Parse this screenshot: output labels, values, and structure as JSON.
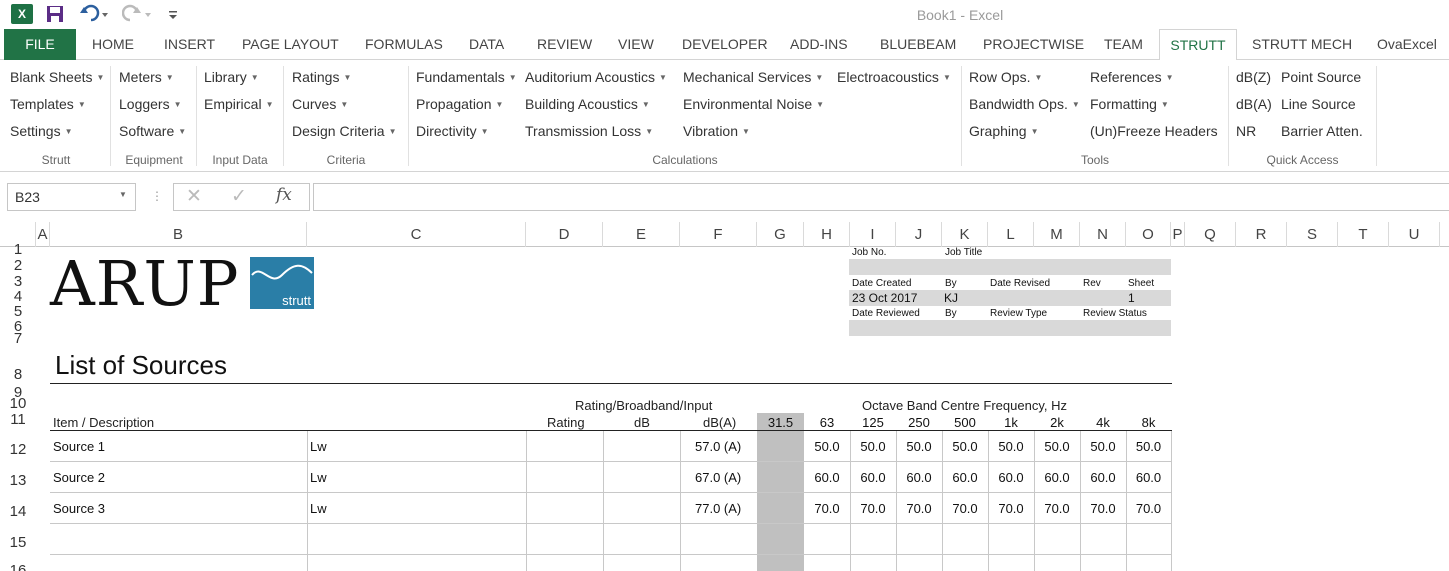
{
  "titlebar": {
    "app_logo": "X",
    "window_title": "Book1 - Excel",
    "icons": [
      "excel-icon",
      "save-icon",
      "undo-icon",
      "redo-icon",
      "customize-qat-icon"
    ]
  },
  "tabs": {
    "file": "FILE",
    "items": [
      "HOME",
      "INSERT",
      "PAGE LAYOUT",
      "FORMULAS",
      "DATA",
      "REVIEW",
      "VIEW",
      "DEVELOPER",
      "ADD-INS",
      "BLUEBEAM",
      "PROJECTWISE",
      "TEAM",
      "STRUTT",
      "STRUTT MECH",
      "OvaExcel"
    ],
    "active": "STRUTT"
  },
  "ribbon": {
    "strutt": {
      "label": "Strutt",
      "items": [
        "Blank Sheets",
        "Templates",
        "Settings"
      ]
    },
    "equipment": {
      "label": "Equipment",
      "items": [
        "Meters",
        "Loggers",
        "Software"
      ]
    },
    "input_data": {
      "label": "Input Data",
      "items": [
        "Library",
        "Empirical"
      ]
    },
    "criteria": {
      "label": "Criteria",
      "items": [
        "Ratings",
        "Curves",
        "Design Criteria"
      ]
    },
    "calculations": {
      "label": "Calculations",
      "col1": [
        "Fundamentals",
        "Propagation",
        "Directivity"
      ],
      "col2": [
        "Auditorium Acoustics",
        "Building Acoustics",
        "Transmission Loss"
      ],
      "col3": [
        "Mechanical Services",
        "Environmental Noise",
        "Vibration"
      ],
      "col4": [
        "Electroacoustics"
      ]
    },
    "tools": {
      "label": "Tools",
      "col1": [
        "Row Ops.",
        "Bandwidth Ops.",
        "Graphing"
      ],
      "col2": [
        "References",
        "Formatting",
        "(Un)Freeze Headers"
      ]
    },
    "quick_access": {
      "label": "Quick Access",
      "col1": [
        "dB(Z)",
        "dB(A)",
        "NR"
      ],
      "col2": [
        "Point Source",
        "Line Source",
        "Barrier Atten."
      ]
    }
  },
  "formula_bar": {
    "name_box": "B23",
    "formula": "",
    "fx": "fx",
    "cancel": "✕",
    "enter": "✓"
  },
  "columns": [
    "A",
    "B",
    "C",
    "D",
    "E",
    "F",
    "G",
    "H",
    "I",
    "J",
    "K",
    "L",
    "M",
    "N",
    "O",
    "P",
    "Q",
    "R",
    "S",
    "T",
    "U"
  ],
  "rows": [
    "1",
    "2",
    "3",
    "4",
    "5",
    "6",
    "7",
    "8",
    "9",
    "10",
    "11",
    "12",
    "13",
    "14",
    "15",
    "16"
  ],
  "sheet": {
    "logo_text": "ARUP",
    "logo_sub": "strutt",
    "info": {
      "job_no_label": "Job No.",
      "job_title_label": "Job Title",
      "date_created_label": "Date Created",
      "by_label": "By",
      "date_revised_label": "Date Revised",
      "rev_label": "Rev",
      "sheet_label": "Sheet",
      "date_created": "23 Oct 2017",
      "by": "KJ",
      "sheet": "1",
      "date_reviewed_label": "Date Reviewed",
      "by2_label": "By",
      "review_type_label": "Review Type",
      "review_status_label": "Review Status"
    },
    "title": "List of Sources",
    "headers": {
      "rating_group": "Rating/Broadband/Input",
      "octave_group": "Octave Band Centre Frequency, Hz",
      "item": "Item / Description",
      "rating": "Rating",
      "db": "dB",
      "dba": "dB(A)",
      "bands": [
        "31.5",
        "63",
        "125",
        "250",
        "500",
        "1k",
        "2k",
        "4k",
        "8k"
      ]
    },
    "sources": [
      {
        "name": "Source 1",
        "type": "Lw",
        "dba": "57.0 (A)",
        "bands": [
          "",
          "50.0",
          "50.0",
          "50.0",
          "50.0",
          "50.0",
          "50.0",
          "50.0",
          "50.0"
        ]
      },
      {
        "name": "Source 2",
        "type": "Lw",
        "dba": "67.0 (A)",
        "bands": [
          "",
          "60.0",
          "60.0",
          "60.0",
          "60.0",
          "60.0",
          "60.0",
          "60.0",
          "60.0"
        ]
      },
      {
        "name": "Source 3",
        "type": "Lw",
        "dba": "77.0 (A)",
        "bands": [
          "",
          "70.0",
          "70.0",
          "70.0",
          "70.0",
          "70.0",
          "70.0",
          "70.0",
          "70.0"
        ]
      }
    ]
  }
}
